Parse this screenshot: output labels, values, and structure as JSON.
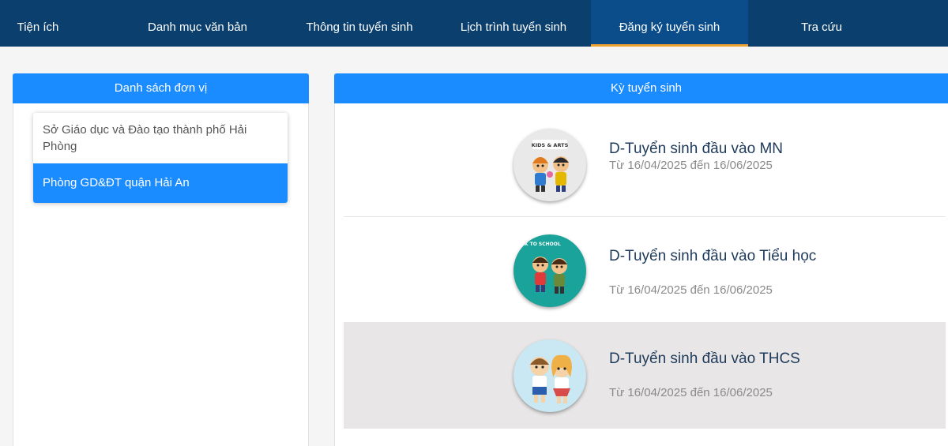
{
  "nav": {
    "items": [
      {
        "label": "Tiện ích"
      },
      {
        "label": "Danh mục văn bản"
      },
      {
        "label": "Thông tin tuyển sinh"
      },
      {
        "label": "Lịch trình tuyển sinh"
      },
      {
        "label": "Đăng ký tuyển sinh"
      },
      {
        "label": "Tra cứu"
      }
    ],
    "active": "Đăng ký tuyển sinh"
  },
  "left_panel": {
    "title": "Danh sách đơn vị",
    "units": [
      {
        "label": "Sở Giáo dục và Đào tạo thành phố Hải Phòng",
        "selected": false
      },
      {
        "label": "Phòng GD&ĐT quận Hải An",
        "selected": true
      }
    ]
  },
  "right_panel": {
    "title": "Kỳ tuyển sinh",
    "terms": [
      {
        "title": "D-Tuyển sinh đầu vào MN",
        "date": "Từ 16/04/2025 đến 16/06/2025",
        "icon": "kids-arts-icon",
        "badge": "KIDS & ARTS"
      },
      {
        "title": "D-Tuyển sinh đầu vào Tiểu học",
        "date": "Từ 16/04/2025 đến 16/06/2025",
        "icon": "back-to-school-icon",
        "badge": "BACK TO SCHOOL"
      },
      {
        "title": "D-Tuyển sinh đầu vào THCS",
        "date": "Từ 16/04/2025 đến 16/06/2025",
        "icon": "students-icon",
        "badge": ""
      }
    ]
  },
  "colors": {
    "nav_bg": "#0b3f6e",
    "accent": "#1a8cff",
    "active_underline": "#f0a030",
    "highlight_row": "#e8e6e6"
  }
}
